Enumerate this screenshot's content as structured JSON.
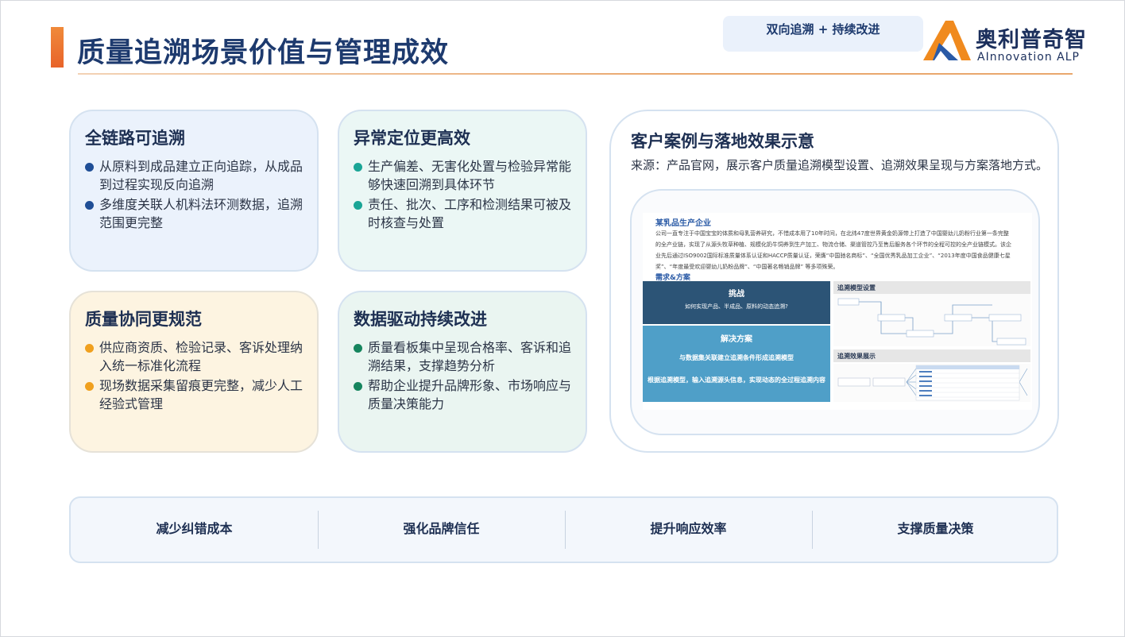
{
  "header": {
    "title": "质量追溯场景价值与管理成效",
    "tag": "双向追溯 + 持续改进"
  },
  "logo": {
    "name_cn": "奥利普奇智",
    "name_en": "AInnovation ALP"
  },
  "cards": [
    {
      "title": "全链路可追溯",
      "dot_color": "#1f4e96",
      "bullets": [
        "从原料到成品建立正向追踪，从成品到过程实现反向追溯",
        "多维度关联人机料法环测数据，追溯范围更完整"
      ]
    },
    {
      "title": "异常定位更高效",
      "dot_color": "#1aa596",
      "bullets": [
        "生产偏差、无害化处置与检验异常能够快速回溯到具体环节",
        "责任、批次、工序和检测结果可被及时核查与处置"
      ]
    },
    {
      "title": "质量协同更规范",
      "dot_color": "#f0a01e",
      "bullets": [
        "供应商资质、检验记录、客诉处理纳入统一标准化流程",
        "现场数据采集留痕更完整，减少人工经验式管理"
      ]
    },
    {
      "title": "数据驱动持续改进",
      "dot_color": "#16855e",
      "bullets": [
        "质量看板集中呈现合格率、客诉和追溯结果，支撑趋势分析",
        "帮助企业提升品牌形象、市场响应与质量决策能力"
      ]
    }
  ],
  "case": {
    "title": "客户案例与落地效果示意",
    "source": "来源：产品官网，展示客户质量追溯模型设置、追溯效果呈现与方案落地方式。",
    "screenshot": {
      "company": "某乳品生产企业",
      "description": "公司一直专注于中国宝宝的体质和母乳营养研究，不惜成本用了10年时间，在北纬47度世界黄金奶源带上打造了中国婴幼儿奶粉行业第一条完整的全产业链，实现了从源头牧草种植、规模化奶牛饲养到生产加工、物流仓储、渠道管控乃至售后服务各个环节的全程可控的全产业链模式。该企业先后通过ISO9002国际标准质量体系认证和HACCP质量认证，荣膺“中国驰名商标”、“全国优秀乳品加工企业”、“2013年度中国食品健康七星奖”、“年度最受欢迎婴幼儿奶粉品牌”、“中国著名畅销品牌” 等多项殊荣。",
      "req_heading": "需求&方案",
      "challenge_heading": "挑战",
      "challenge_text": "如何实现产品、半成品、原料的动态追溯?",
      "solution_heading": "解决方案",
      "solution_text_1": "与数据集关联建立追溯条件形成追溯模型",
      "solution_text_2": "根据追溯模型，输入追溯源头信息，实现动态的全过程追溯内容",
      "panel_model": "追溯模型设置",
      "panel_result": "追溯效果展示"
    }
  },
  "benefits": [
    "减少纠错成本",
    "强化品牌信任",
    "提升响应效率",
    "支撑质量决策"
  ]
}
